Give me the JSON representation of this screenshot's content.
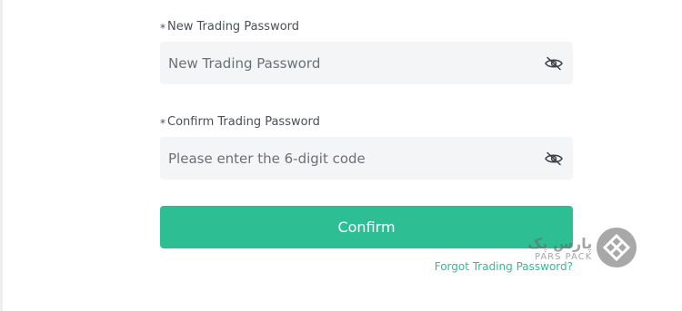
{
  "new_password": {
    "required_marker": "*",
    "label": "New Trading Password",
    "placeholder": "New Trading Password",
    "value": "",
    "toggle_icon": "eye-slash-icon"
  },
  "confirm_password": {
    "required_marker": "*",
    "label": "Confirm Trading Password",
    "placeholder": "Please enter the 6-digit code",
    "value": "",
    "toggle_icon": "eye-slash-icon"
  },
  "confirm_button": {
    "label": "Confirm"
  },
  "forgot_link": {
    "label": "Forgot Trading Password?"
  },
  "watermark": {
    "fa_text": "پارس پک",
    "en_text": "PARS PACK"
  },
  "colors": {
    "accent": "#2dbe94",
    "input_bg": "#f4f5f7",
    "label_text": "#4a4f57",
    "placeholder_text": "#6b7077"
  }
}
